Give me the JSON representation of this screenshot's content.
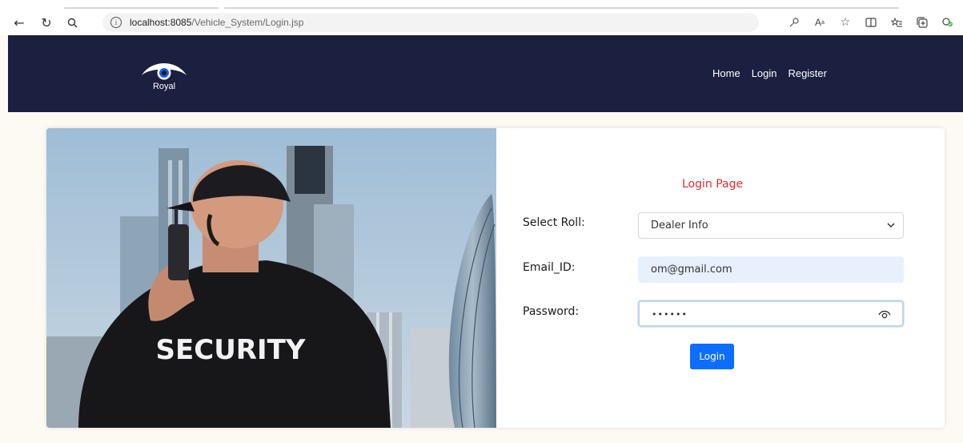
{
  "browser": {
    "url_host": "localhost:8085",
    "url_path": "/Vehicle_System/Login.jsp",
    "info_glyph": "i"
  },
  "header": {
    "logo_text": "Royal",
    "nav": [
      "Home",
      "Login",
      "Register"
    ]
  },
  "hero": {
    "jacket_text": "SECURITY"
  },
  "form": {
    "title": "Login Page",
    "role_label": "Select Roll:",
    "role_value": "Dealer Info",
    "email_label": "Email_ID:",
    "email_value": "om@gmail.com",
    "password_label": "Password:",
    "password_masked": "••••••",
    "login_button": "Login"
  },
  "colors": {
    "header_bg": "#1b1f40",
    "title_red": "#e0292a",
    "button_blue": "#0d6efd",
    "autofill_bg": "#e8f0fe"
  }
}
